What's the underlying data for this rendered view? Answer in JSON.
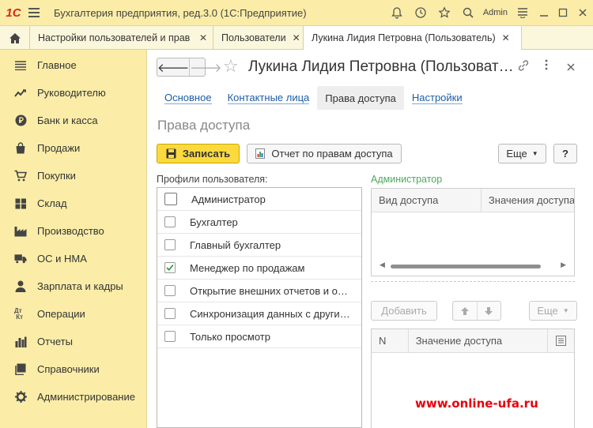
{
  "app": {
    "logo": "1С",
    "title": "Бухгалтерия предприятия, ред.3.0  (1С:Предприятие)",
    "user": "Admin"
  },
  "tabs": [
    {
      "label": "Настройки пользователей и прав",
      "active": false
    },
    {
      "label": "Пользователи",
      "active": false
    },
    {
      "label": "Лукина Лидия Петровна (Пользователь)",
      "active": true
    }
  ],
  "sidebar": {
    "items": [
      {
        "label": "Главное",
        "icon": "list-icon"
      },
      {
        "label": "Руководителю",
        "icon": "chart-trend-icon"
      },
      {
        "label": "Банк и касса",
        "icon": "ruble-coin-icon"
      },
      {
        "label": "Продажи",
        "icon": "shopping-bag-icon"
      },
      {
        "label": "Покупки",
        "icon": "cart-icon"
      },
      {
        "label": "Склад",
        "icon": "warehouse-icon"
      },
      {
        "label": "Производство",
        "icon": "factory-icon"
      },
      {
        "label": "ОС и НМА",
        "icon": "truck-icon"
      },
      {
        "label": "Зарплата и кадры",
        "icon": "person-icon"
      },
      {
        "label": "Операции",
        "icon": "debit-credit-icon"
      },
      {
        "label": "Отчеты",
        "icon": "bar-chart-icon"
      },
      {
        "label": "Справочники",
        "icon": "books-icon"
      },
      {
        "label": "Администрирование",
        "icon": "gear-icon"
      }
    ]
  },
  "form": {
    "title": "Лукина Лидия Петровна (Пользоват…",
    "tabs": [
      "Основное",
      "Контактные лица",
      "Права доступа",
      "Настройки"
    ],
    "active_tab": "Права доступа",
    "section_title": "Права доступа",
    "buttons": {
      "save": "Записать",
      "report": "Отчет по правам доступа",
      "more": "Еще",
      "help": "?",
      "add": "Добавить",
      "more2": "Еще"
    },
    "profiles_label": "Профили пользователя:",
    "profiles": [
      {
        "label": "Администратор",
        "checked": false
      },
      {
        "label": "Бухгалтер",
        "checked": false
      },
      {
        "label": "Главный бухгалтер",
        "checked": false
      },
      {
        "label": "Менеджер по продажам",
        "checked": true
      },
      {
        "label": "Открытие внешних отчетов и обработок",
        "checked": false
      },
      {
        "label": "Синхронизация данных с другими программами",
        "checked": false
      },
      {
        "label": "Только просмотр",
        "checked": false
      }
    ],
    "selected_profile": "Администратор",
    "access_grid": {
      "columns": [
        "Вид доступа",
        "Значения доступа"
      ]
    },
    "values_grid": {
      "columns": [
        "N",
        "Значение доступа"
      ]
    }
  },
  "watermark": "www.online-ufa.ru"
}
